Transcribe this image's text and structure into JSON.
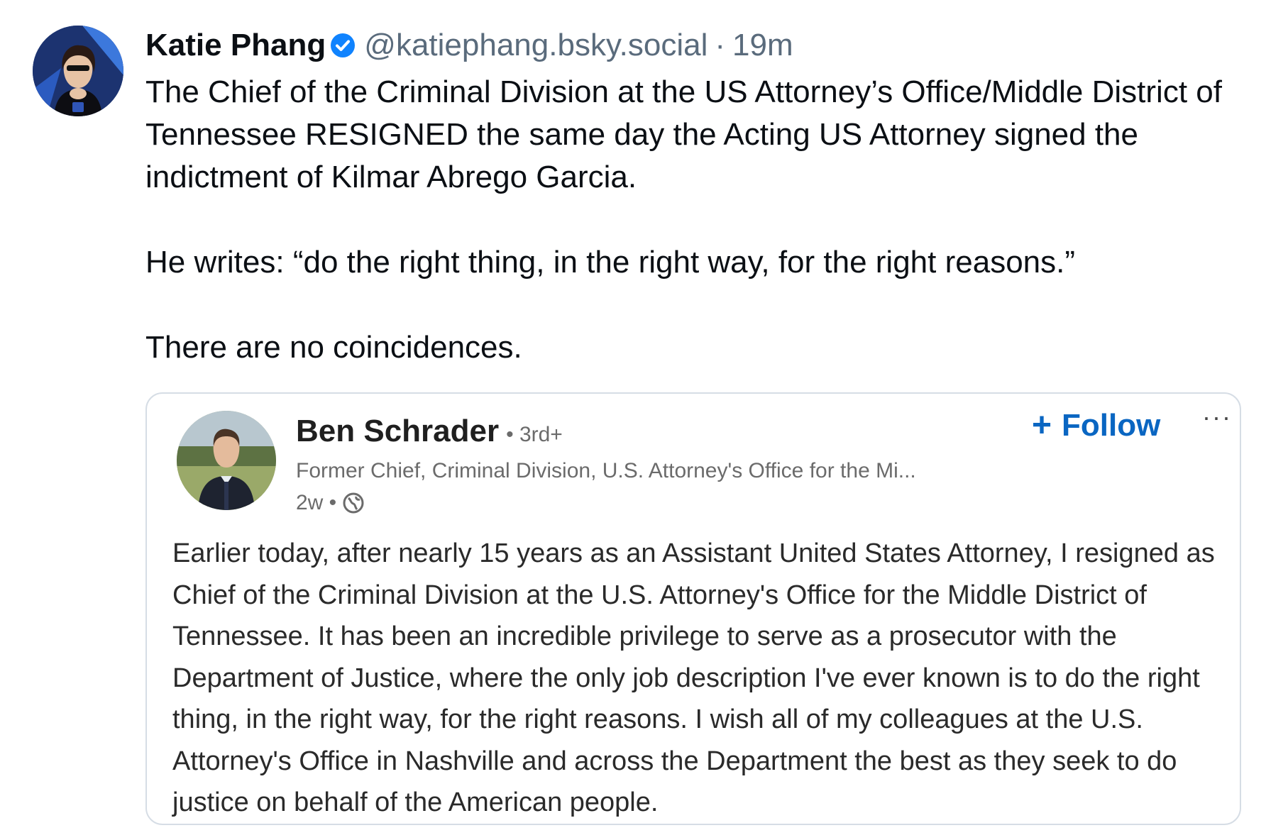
{
  "post": {
    "author": {
      "display_name": "Katie Phang",
      "handle": "@katiephang.bsky.social",
      "verified_icon": "verified-check-icon",
      "avatar_icon": "avatar-image"
    },
    "separator": "·",
    "time": "19m",
    "paragraphs": [
      "The Chief of the Criminal Division at the US Attorney’s Office/Middle District of Tennessee RESIGNED the same day the Acting US Attorney signed the indictment of Kilmar Abrego Garcia.",
      "He writes: “do the right thing, in the right way, for the right reasons.”",
      "There are no coincidences."
    ],
    "embed": {
      "author_name": "Ben Schrader",
      "degree": "• 3rd+",
      "headline": "Former Chief, Criminal Division, U.S. Attorney's Office for the Mi...",
      "age": "2w •",
      "visibility_icon": "globe-icon",
      "follow_label": "Follow",
      "follow_icon": "plus-icon",
      "more_icon": "more-dots-icon",
      "more_label": "···",
      "body": "Earlier today, after nearly 15 years as an Assistant United States Attorney, I resigned as Chief of the Criminal Division at the U.S. Attorney's Office for the Middle District of Tennessee. It has been an incredible privilege to serve as a prosecutor with the Department of Justice, where the only job description I've ever known is to do the right thing, in the right way, for the right reasons. I wish all of my colleagues at the U.S. Attorney's Office in Nashville and across the Department the best as they seek to do justice on behalf of the American people."
    }
  },
  "colors": {
    "text": "#0b0f14",
    "muted": "#5a6b7c",
    "verified": "#1083fe",
    "linkedin_blue": "#0a66c2",
    "embed_border": "#d6dde5"
  }
}
